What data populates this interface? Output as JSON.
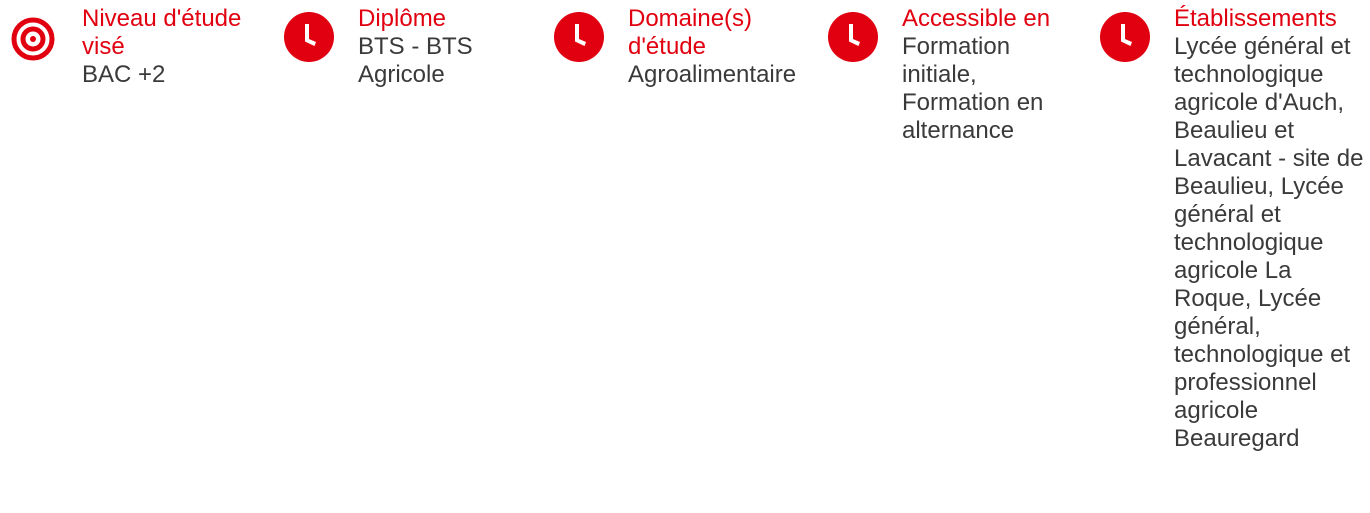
{
  "colors": {
    "accent": "#e1000f",
    "text": "#3a3a3a"
  },
  "items": [
    {
      "icon": "target-icon",
      "label": "Niveau d'étude visé",
      "value": "BAC +2"
    },
    {
      "icon": "clock-icon",
      "label": "Diplôme",
      "value": "BTS - BTS Agricole"
    },
    {
      "icon": "clock-icon",
      "label": "Domaine(s) d'étude",
      "value": "Agroalimentaire"
    },
    {
      "icon": "clock-icon",
      "label": "Accessible en",
      "value": "Formation initiale, Formation en alternance"
    },
    {
      "icon": "clock-icon",
      "label": "Établissements",
      "value": "Lycée général et technologique agricole d'Auch, Beaulieu et Lavacant - site de Beaulieu, Lycée général et technologique agricole La Roque, Lycée général, technologique et professionnel agricole Beauregard"
    }
  ]
}
